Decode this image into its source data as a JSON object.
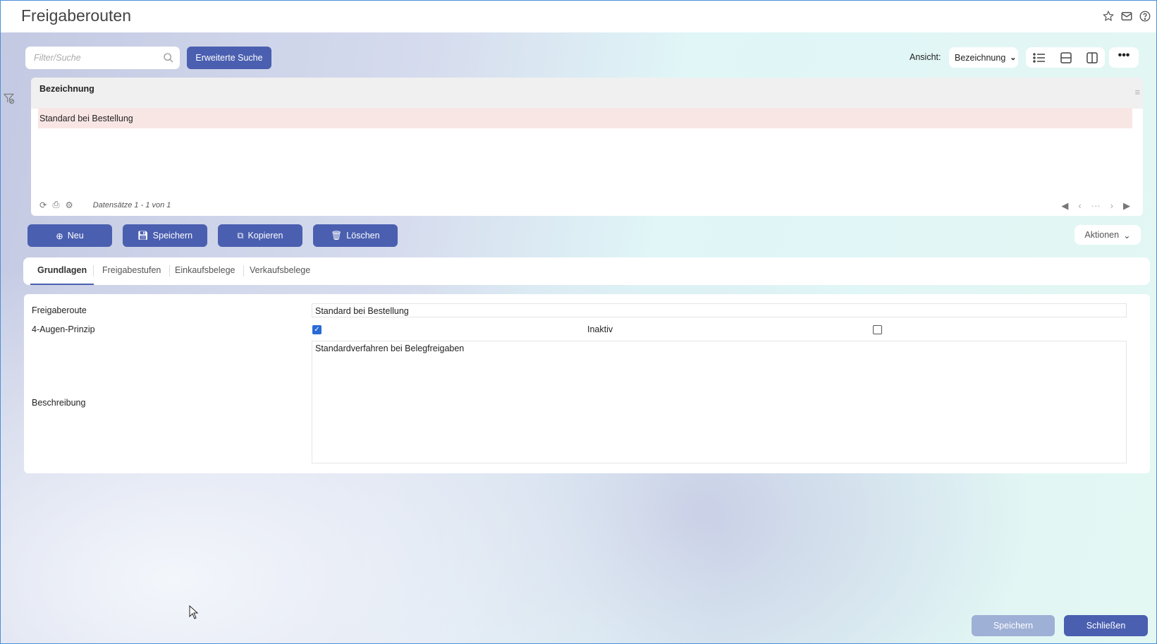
{
  "header": {
    "title": "Freigaberouten"
  },
  "toolbar": {
    "search_placeholder": "Filter/Suche",
    "advanced_search": "Erweiterte Suche",
    "view_label": "Ansicht:",
    "view_value": "Bezeichnung"
  },
  "grid": {
    "column": "Bezeichnung",
    "rows": [
      "Standard bei Bestellung"
    ],
    "records": "Datensätze 1 - 1 von 1"
  },
  "actions": {
    "new": "Neu",
    "save": "Speichern",
    "copy": "Kopieren",
    "delete": "Löschen",
    "more": "Aktionen"
  },
  "tabs": [
    "Grundlagen",
    "Freigabestufen",
    "Einkaufsbelege",
    "Verkaufsbelege"
  ],
  "form": {
    "route_label": "Freigaberoute",
    "route_value": "Standard bei Bestellung",
    "four_eyes_label": "4-Augen-Prinzip",
    "four_eyes_checked": true,
    "inactive_label": "Inaktiv",
    "inactive_checked": false,
    "description_label": "Beschreibung",
    "description_value": "Standardverfahren bei Belegfreigaben"
  },
  "footer": {
    "save": "Speichern",
    "close": "Schließen"
  }
}
